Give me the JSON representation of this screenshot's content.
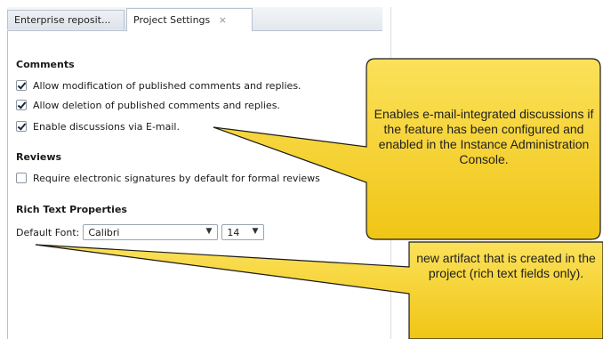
{
  "tabs": [
    {
      "label": "Enterprise reposit..."
    },
    {
      "label": "Project Settings",
      "close": "×"
    }
  ],
  "comments": {
    "title": "Comments",
    "options": [
      {
        "label": "Allow modification of published comments and replies.",
        "checked": true
      },
      {
        "label": "Allow deletion of published comments and replies.",
        "checked": true
      },
      {
        "label": "Enable discussions via E-mail.",
        "checked": true
      }
    ]
  },
  "reviews": {
    "title": "Reviews",
    "options": [
      {
        "label": "Require electronic signatures by default for formal reviews",
        "checked": false
      }
    ]
  },
  "rich_text": {
    "title": "Rich Text Properties",
    "font_label": "Default Font:",
    "font_value": "Calibri",
    "size_value": "14"
  },
  "callouts": {
    "top": "Enables e-mail-integrated discussions if the feature has been configured and enabled in the Instance Administration Console.",
    "bottom": "new artifact that is created in the project (rich text fields only)."
  },
  "colors": {
    "callout_fill": "#F7CF1F",
    "callout_stroke": "#1a1a1a"
  }
}
